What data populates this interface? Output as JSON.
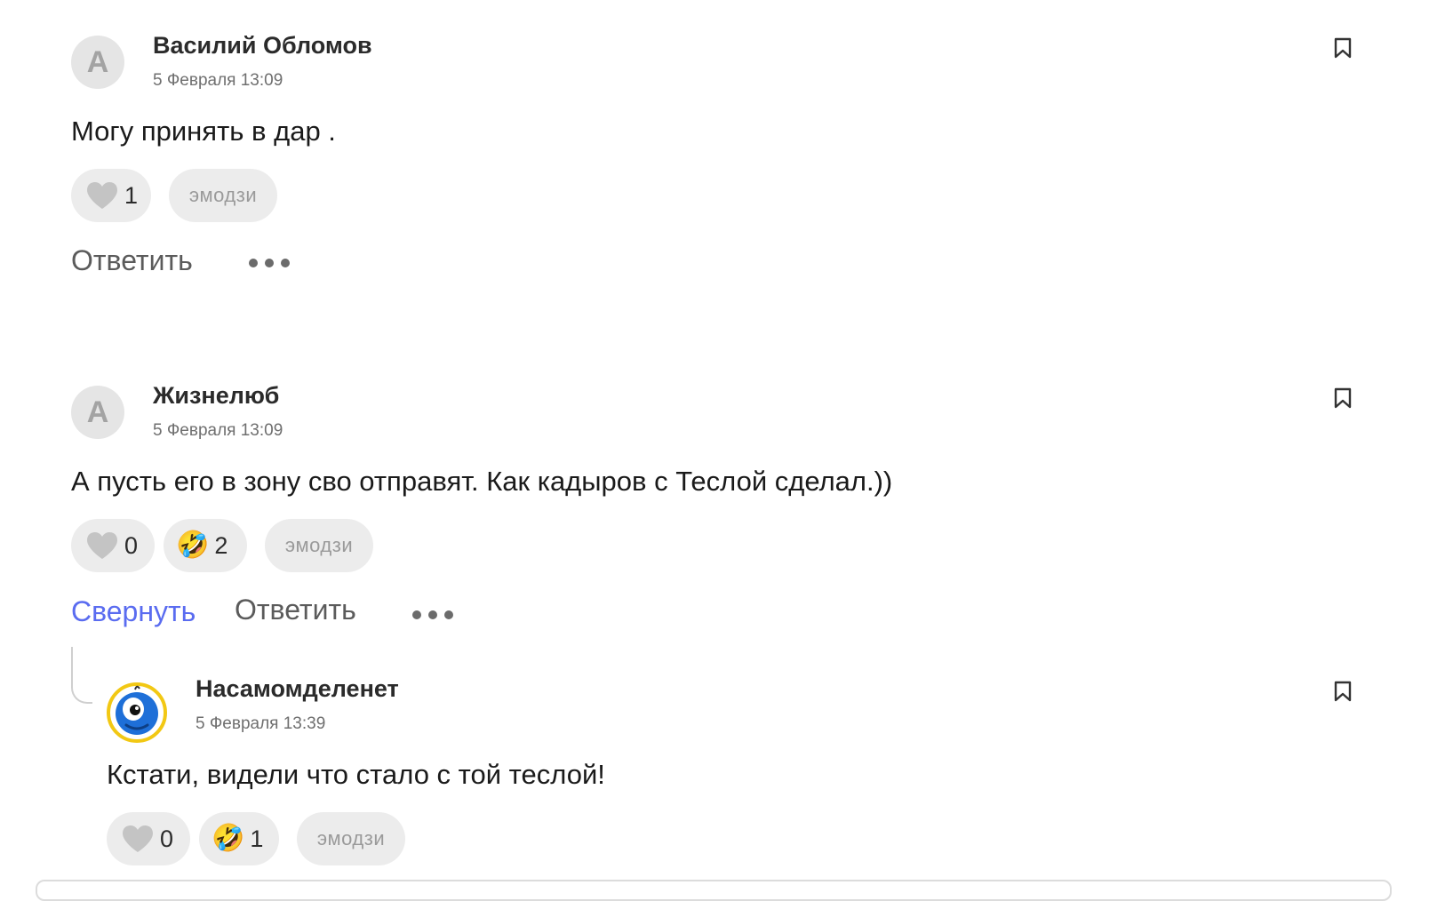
{
  "comments": [
    {
      "avatar_letter": "А",
      "author": "Василий Обломов",
      "date": "5 Февраля 13:09",
      "text": "Могу принять в дар .",
      "likes": "1",
      "emoji_label": "эмодзи",
      "reply_label": "Ответить"
    },
    {
      "avatar_letter": "А",
      "author": "Жизнелюб",
      "date": "5 Февраля 13:09",
      "text": "А пусть его в зону сво отправят. Как кадыров с Теслой сделал.))",
      "likes": "0",
      "laugh_emoji": "🤣",
      "laugh_count": "2",
      "emoji_label": "эмодзи",
      "collapse_label": "Свернуть",
      "reply_label": "Ответить"
    }
  ],
  "reply": {
    "author": "Насамомделенет",
    "date": "5 Февраля 13:39",
    "text": "Кстати, видели что стало с той теслой!",
    "likes": "0",
    "laugh_emoji": "🤣",
    "laugh_count": "1",
    "emoji_label": "эмодзи"
  },
  "colors": {
    "accent_link": "#5a6cf0",
    "pill_bg": "#ececec",
    "heart": "#c4c4c4"
  }
}
